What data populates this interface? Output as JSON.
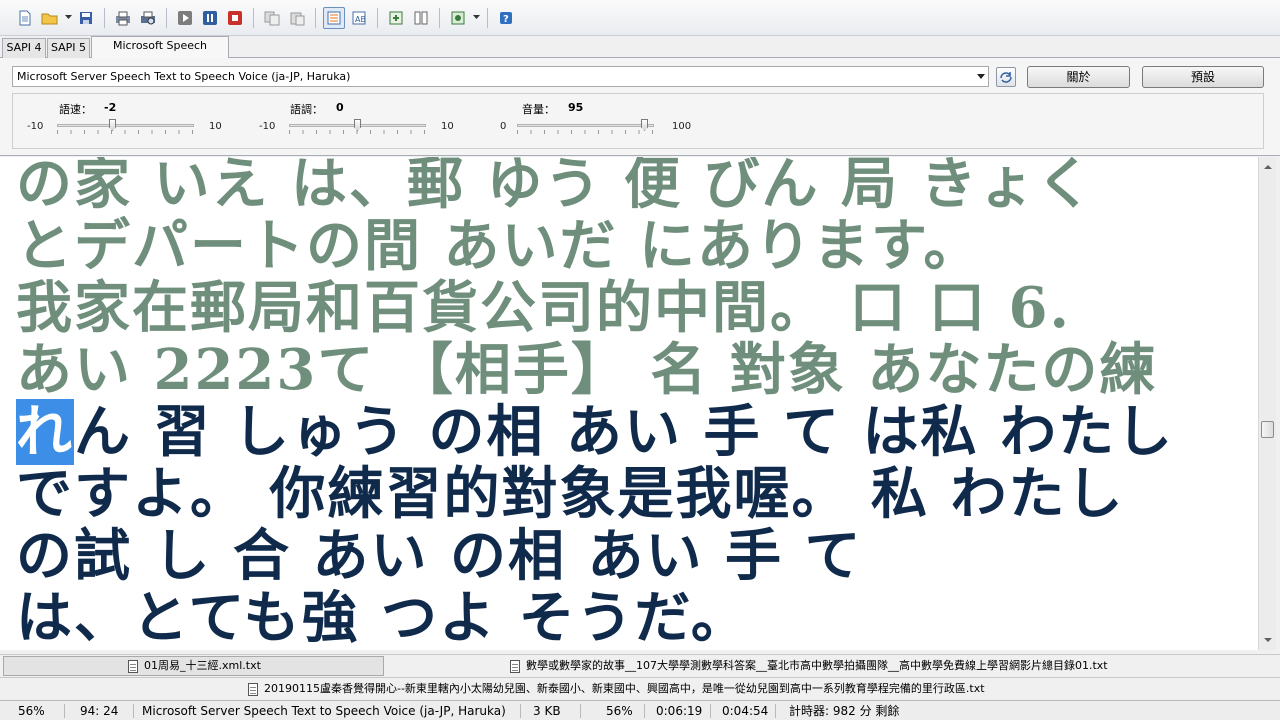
{
  "tabs": [
    {
      "label": "SAPI 4"
    },
    {
      "label": "SAPI 5"
    },
    {
      "label": "Microsoft Speech Platform"
    }
  ],
  "voice": {
    "selected": "Microsoft Server Speech Text to Speech Voice (ja-JP, Haruka)"
  },
  "buttons": {
    "about": "關於",
    "default": "預設"
  },
  "sliders": {
    "rate": {
      "label": "語速：",
      "value": "-2",
      "min": "-10",
      "max": "10",
      "fraction": 0.4
    },
    "pitch": {
      "label": "語調：",
      "value": "0",
      "min": "-10",
      "max": "10",
      "fraction": 0.5
    },
    "volume": {
      "label": "音量：",
      "value": "95",
      "min": "0",
      "max": "100",
      "fraction": 0.95
    }
  },
  "text": {
    "spoken_lines": [
      "の家 いえ は、郵 ゆう 便 びん 局 きょく",
      "とデパートの間 あいだ にあります。",
      "我家在郵局和百貨公司的中間。 口 口 6.",
      "あい 2223て 【相手】 名 對象 あなたの練"
    ],
    "current_char": "れ",
    "current_rest": "ん 習 しゅう の相 あい 手 て は私 わたし",
    "unspoken_lines": [
      "ですよ。 你練習的對象是我喔。 私 わたし",
      "の試 し 合 あい の相 あい 手 て",
      "は、とても強 つよ そうだ。"
    ]
  },
  "files": {
    "row1": [
      {
        "name": "01周易_十三經.xml.txt"
      },
      {
        "name": "數學或數學家的故事__107大學學測數學科答案__臺北市高中數學拍攝團隊__高中數學免費線上學習網影片總目錄01.txt"
      }
    ],
    "row2": [
      {
        "name": "20190115盧秦香覺得開心--新東里轄內小太陽幼兒園、新泰國小、新東國中、興國高中，是唯一從幼兒園到高中一系列教育學程完備的里行政區.txt"
      }
    ]
  },
  "status": {
    "zoom": "56%",
    "position": "94: 24",
    "voice": "Microsoft Server Speech Text to Speech Voice (ja-JP, Haruka)",
    "size": "3 KB",
    "progress": "56%",
    "elapsed": "0:06:19",
    "remaining": "0:04:54",
    "timer": "計時器: 982 分 剩餘"
  },
  "colors": {
    "spoken_text": "#6f8f7c",
    "unspoken_text": "#102a4c",
    "highlight": "#3d8ee6"
  }
}
